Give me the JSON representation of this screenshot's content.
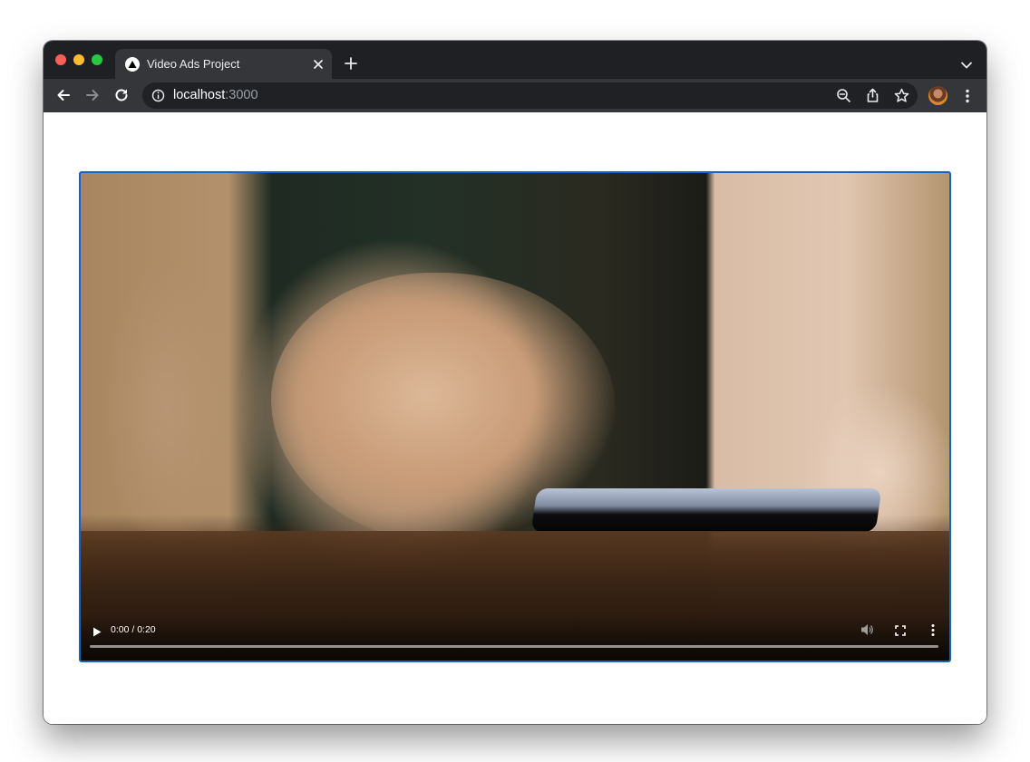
{
  "browser": {
    "tab": {
      "title": "Video Ads Project",
      "favicon": "triangle-logo-icon",
      "close_icon": "close-icon"
    },
    "new_tab_icon": "plus-icon",
    "tab_menu_icon": "chevron-down-icon",
    "toolbar": {
      "back_icon": "arrow-left-icon",
      "forward_icon": "arrow-right-icon",
      "reload_icon": "reload-icon",
      "site_info_icon": "info-icon",
      "url_host": "localhost",
      "url_port": ":3000",
      "zoom_icon": "zoom-out-icon",
      "share_icon": "share-icon",
      "bookmark_icon": "star-icon",
      "profile_icon": "avatar",
      "menu_icon": "kebab-menu-icon"
    },
    "colors": {
      "close": "#ff5f57",
      "minimize": "#febc2e",
      "maximize": "#28c840",
      "frame": "#1f2023",
      "toolbar": "#35363a",
      "omnibox": "#202124"
    }
  },
  "video": {
    "time_display": "0:00 / 0:20",
    "progress": 0,
    "frame_border_color": "#1565c0",
    "controls": {
      "play_icon": "play-icon",
      "volume_icon": "volume-icon",
      "fullscreen_icon": "fullscreen-icon",
      "more_icon": "more-options-icon"
    }
  }
}
